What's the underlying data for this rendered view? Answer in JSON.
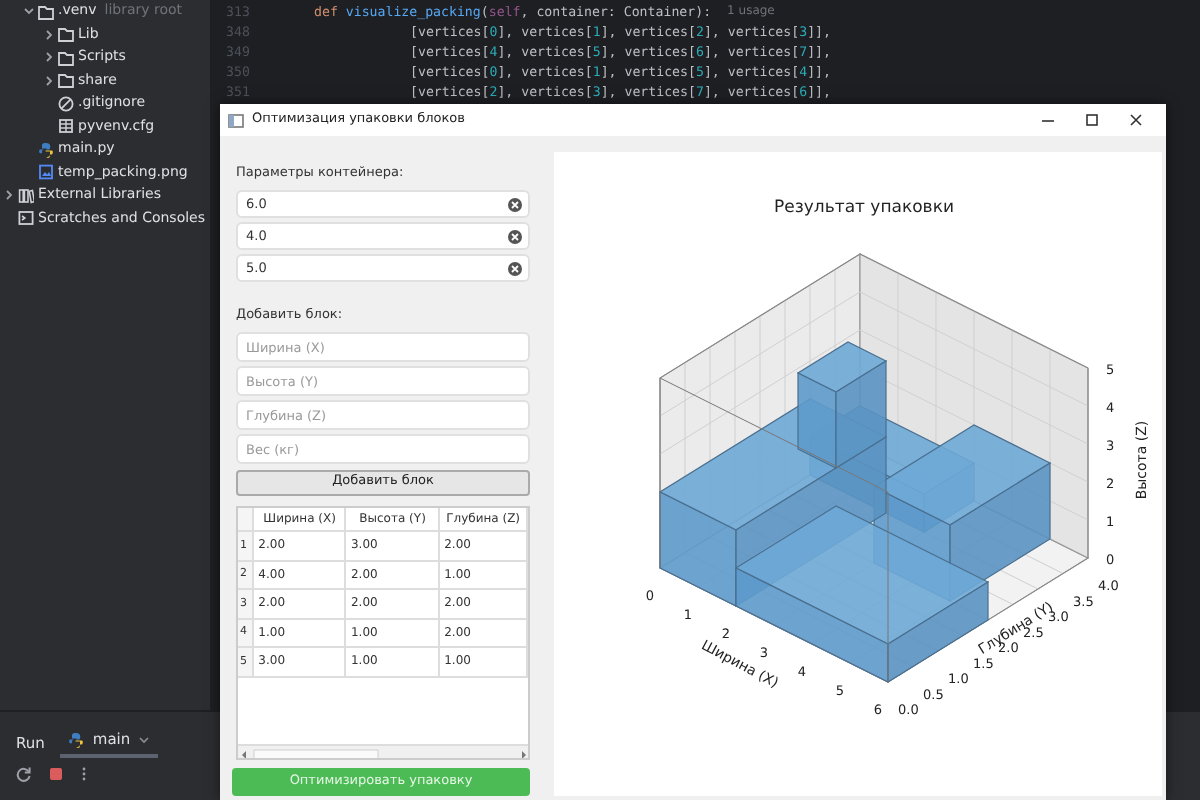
{
  "ide": {
    "project_tree": [
      {
        "label": ".venv",
        "hint": "library root",
        "kind": "folder",
        "expanded": true,
        "children": [
          {
            "label": "Lib",
            "kind": "folder",
            "expanded": false
          },
          {
            "label": "Scripts",
            "kind": "folder",
            "expanded": false
          },
          {
            "label": "share",
            "kind": "folder",
            "expanded": false
          },
          {
            "label": ".gitignore",
            "kind": "ignore-file"
          },
          {
            "label": "pyvenv.cfg",
            "kind": "config-file"
          }
        ]
      },
      {
        "label": "main.py",
        "kind": "python-file"
      },
      {
        "label": "temp_packing.png",
        "kind": "image-file"
      }
    ],
    "root_items": [
      {
        "label": "External Libraries",
        "kind": "library",
        "expanded": false
      },
      {
        "label": "Scratches and Consoles",
        "kind": "scratch"
      }
    ],
    "editor": {
      "lines": [
        {
          "number": "313",
          "kind": "def",
          "tokens": [
            {
              "text": "def ",
              "kind": "keyword"
            },
            {
              "text": "visualize_packing",
              "kind": "function"
            },
            {
              "text": "(",
              "kind": "plain"
            },
            {
              "text": "self",
              "kind": "self"
            },
            {
              "text": ", container: Container):",
              "kind": "plain"
            }
          ],
          "hint": "1 usage"
        },
        {
          "number": "348",
          "kind": "continuation",
          "tokens": [
            {
              "text": "[vertices[",
              "kind": "plain"
            },
            {
              "text": "0",
              "kind": "number"
            },
            {
              "text": "], vertices[",
              "kind": "plain"
            },
            {
              "text": "1",
              "kind": "number"
            },
            {
              "text": "], vertices[",
              "kind": "plain"
            },
            {
              "text": "2",
              "kind": "number"
            },
            {
              "text": "], vertices[",
              "kind": "plain"
            },
            {
              "text": "3",
              "kind": "number"
            },
            {
              "text": "]],",
              "kind": "plain"
            }
          ]
        },
        {
          "number": "349",
          "kind": "continuation",
          "tokens": [
            {
              "text": "[vertices[",
              "kind": "plain"
            },
            {
              "text": "4",
              "kind": "number"
            },
            {
              "text": "], vertices[",
              "kind": "plain"
            },
            {
              "text": "5",
              "kind": "number"
            },
            {
              "text": "], vertices[",
              "kind": "plain"
            },
            {
              "text": "6",
              "kind": "number"
            },
            {
              "text": "], vertices[",
              "kind": "plain"
            },
            {
              "text": "7",
              "kind": "number"
            },
            {
              "text": "]],",
              "kind": "plain"
            }
          ]
        },
        {
          "number": "350",
          "kind": "continuation",
          "tokens": [
            {
              "text": "[vertices[",
              "kind": "plain"
            },
            {
              "text": "0",
              "kind": "number"
            },
            {
              "text": "], vertices[",
              "kind": "plain"
            },
            {
              "text": "1",
              "kind": "number"
            },
            {
              "text": "], vertices[",
              "kind": "plain"
            },
            {
              "text": "5",
              "kind": "number"
            },
            {
              "text": "], vertices[",
              "kind": "plain"
            },
            {
              "text": "4",
              "kind": "number"
            },
            {
              "text": "]],",
              "kind": "plain"
            }
          ]
        },
        {
          "number": "351",
          "kind": "continuation",
          "tokens": [
            {
              "text": "[vertices[",
              "kind": "plain"
            },
            {
              "text": "2",
              "kind": "number"
            },
            {
              "text": "], vertices[",
              "kind": "plain"
            },
            {
              "text": "3",
              "kind": "number"
            },
            {
              "text": "], vertices[",
              "kind": "plain"
            },
            {
              "text": "7",
              "kind": "number"
            },
            {
              "text": "], vertices[",
              "kind": "plain"
            },
            {
              "text": "6",
              "kind": "number"
            },
            {
              "text": "]],",
              "kind": "plain"
            }
          ]
        }
      ]
    },
    "run_panel": {
      "title": "Run",
      "tabs": [
        {
          "label": "main",
          "selected": true
        }
      ]
    }
  },
  "dialog": {
    "title": "Оптимизация упаковки блоков",
    "container_section": {
      "label": "Параметры контейнера:",
      "fields": [
        {
          "value": "6.0"
        },
        {
          "value": "4.0"
        },
        {
          "value": "5.0"
        }
      ]
    },
    "block_section": {
      "label": "Добавить блок:",
      "fields": [
        {
          "placeholder": "Ширина (X)"
        },
        {
          "placeholder": "Высота (Y)"
        },
        {
          "placeholder": "Глубина (Z)"
        },
        {
          "placeholder": "Вес (кг)"
        }
      ],
      "add_button": "Добавить блок"
    },
    "blocks_table": {
      "columns": [
        "Ширина (X)",
        "Высота (Y)",
        "Глубина (Z)"
      ],
      "rows": [
        {
          "number": "1",
          "cells": [
            "2.00",
            "3.00",
            "2.00"
          ]
        },
        {
          "number": "2",
          "cells": [
            "4.00",
            "2.00",
            "1.00"
          ]
        },
        {
          "number": "3",
          "cells": [
            "2.00",
            "2.00",
            "2.00"
          ]
        },
        {
          "number": "4",
          "cells": [
            "1.00",
            "1.00",
            "2.00"
          ]
        },
        {
          "number": "5",
          "cells": [
            "3.00",
            "1.00",
            "1.00"
          ]
        }
      ]
    },
    "optimize_button": "Оптимизировать упаковку",
    "plot": {
      "title": "Результат упаковки",
      "xlabel": "Ширина (X)",
      "ylabel": "Глубина (Y)",
      "zlabel": "Высота (Z)",
      "xticks": [
        "0",
        "1",
        "2",
        "3",
        "4",
        "5",
        "6"
      ],
      "yticks": [
        "0.0",
        "0.5",
        "1.0",
        "1.5",
        "2.0",
        "2.5",
        "3.0",
        "3.5",
        "4.0"
      ],
      "zticks": [
        "5",
        "4",
        "3",
        "2",
        "1",
        "0"
      ]
    }
  }
}
